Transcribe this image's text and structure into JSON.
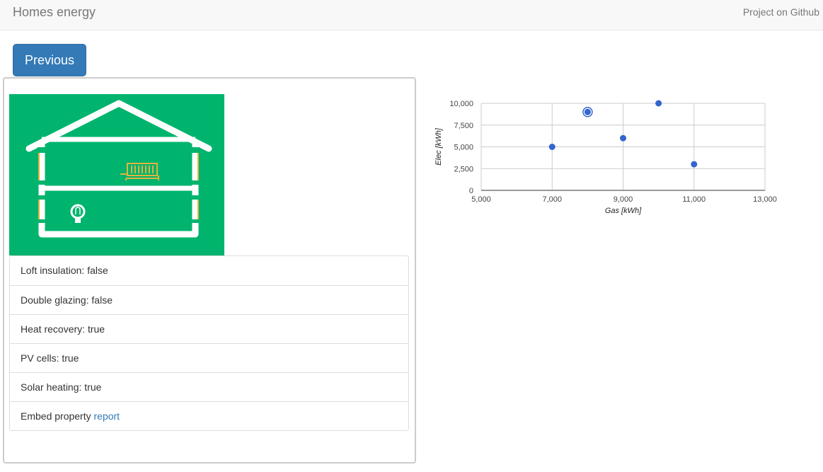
{
  "navbar": {
    "brand": "Homes energy",
    "github_link": "Project on Github"
  },
  "buttons": {
    "previous": "Previous"
  },
  "house_icons": [
    "house-outline-icon",
    "radiator-icon",
    "light-bulb-icon"
  ],
  "colors": {
    "house_bg": "#00b46e",
    "house_lines": "#ffffff",
    "accents": "#e1b33f",
    "button": "#337ab7",
    "points": "#3366cc"
  },
  "features": [
    {
      "key": "Loft insulation:",
      "value": "false"
    },
    {
      "key": "Double glazing:",
      "value": "false"
    },
    {
      "key": "Heat recovery:",
      "value": "true"
    },
    {
      "key": "PV cells:",
      "value": "true"
    },
    {
      "key": "Solar heating:",
      "value": "true"
    }
  ],
  "embed": {
    "text": "Embed property",
    "link": "report"
  },
  "chart_data": {
    "type": "scatter",
    "xlabel": "Gas [kWh]",
    "ylabel": "Elec [kWh]",
    "xlim": [
      5000,
      13000
    ],
    "ylim": [
      0,
      10000
    ],
    "x_ticks": [
      "5,000",
      "7,000",
      "9,000",
      "11,000",
      "13,000"
    ],
    "y_ticks": [
      "0",
      "2,500",
      "5,000",
      "7,500",
      "10,000"
    ],
    "grid": true,
    "legend": "none",
    "points": [
      {
        "x": 7000,
        "y": 5000
      },
      {
        "x": 8000,
        "y": 9000,
        "selected": true
      },
      {
        "x": 9000,
        "y": 6000
      },
      {
        "x": 10000,
        "y": 10000
      },
      {
        "x": 11000,
        "y": 3000
      }
    ]
  }
}
